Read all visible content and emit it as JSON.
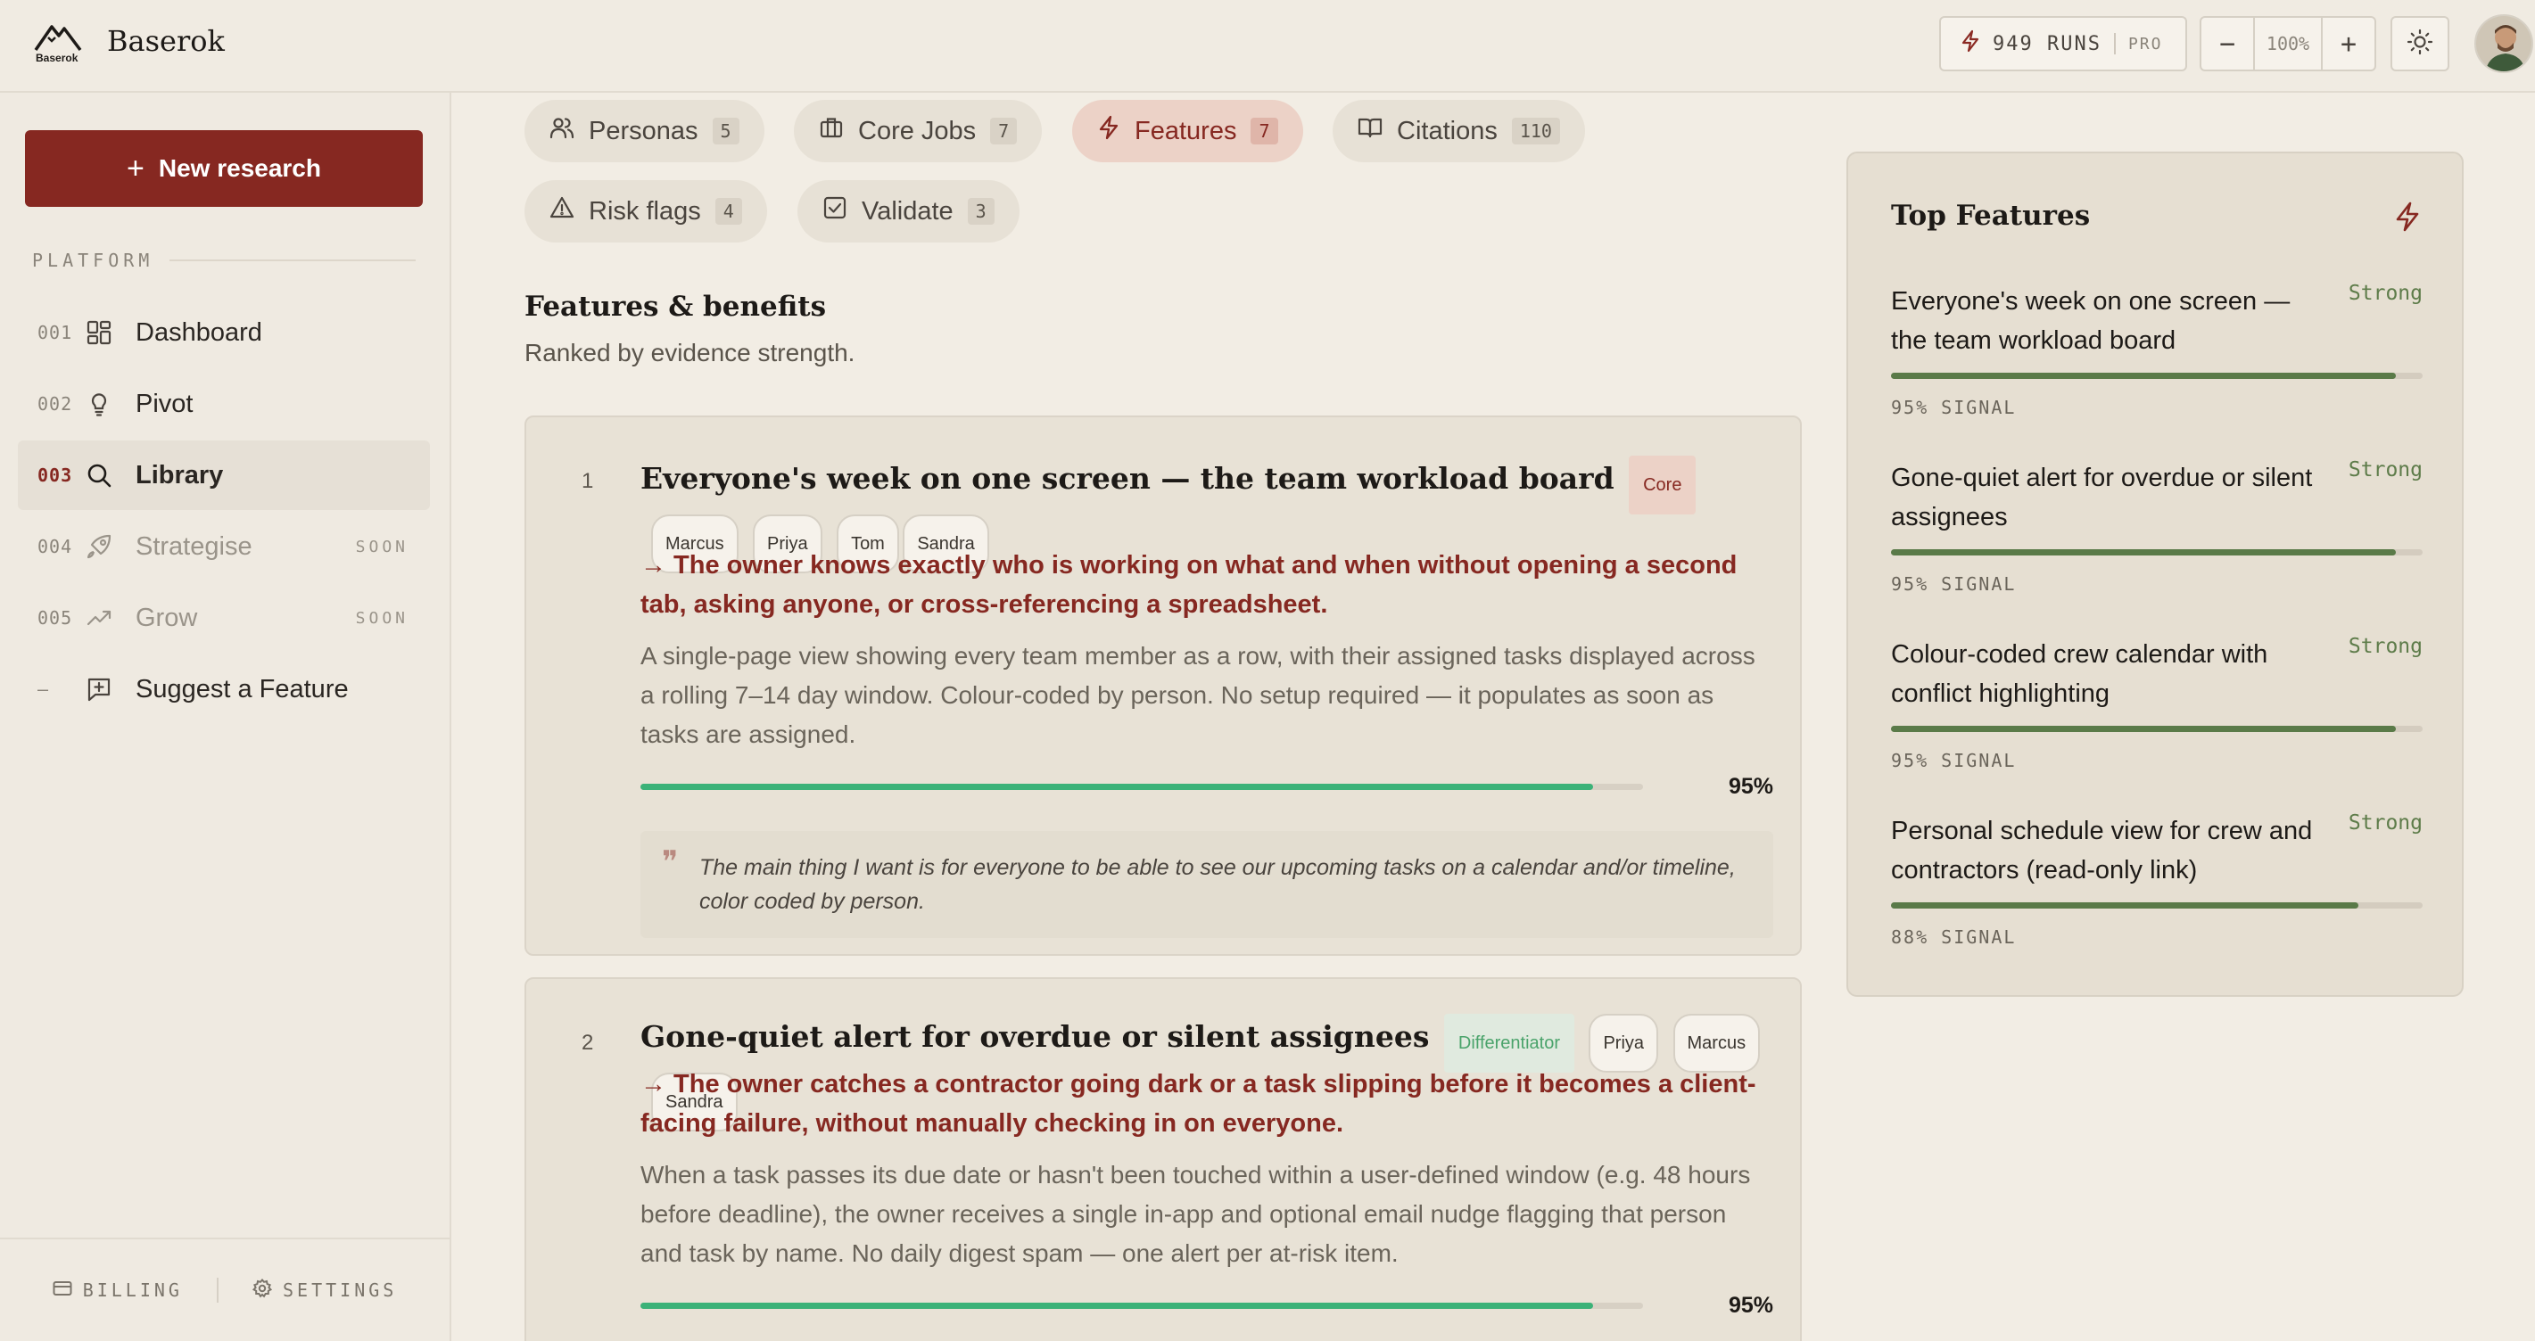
{
  "header": {
    "brand_name": "Baserok",
    "brand_logo_text": "Baserok",
    "runs_label": "949 RUNS",
    "plan_label": "PRO",
    "zoom_value": "100%",
    "zoom_out_label": "−",
    "zoom_in_label": "+"
  },
  "sidebar": {
    "new_research_label": "New research",
    "section_label": "PLATFORM",
    "items": [
      {
        "num": "001",
        "label": "Dashboard",
        "icon": "grid-icon",
        "soon": ""
      },
      {
        "num": "002",
        "label": "Pivot",
        "icon": "lightbulb-icon",
        "soon": ""
      },
      {
        "num": "003",
        "label": "Library",
        "icon": "search-icon",
        "soon": "",
        "active": true
      },
      {
        "num": "004",
        "label": "Strategise",
        "icon": "rocket-icon",
        "soon": "SOON"
      },
      {
        "num": "005",
        "label": "Grow",
        "icon": "trending-up-icon",
        "soon": "SOON"
      },
      {
        "num": "–",
        "label": "Suggest a Feature",
        "icon": "message-plus-icon",
        "soon": ""
      }
    ],
    "footer": {
      "billing_label": "BILLING",
      "settings_label": "SETTINGS"
    }
  },
  "tabs": [
    {
      "label": "Personas",
      "count": "5",
      "icon": "users-icon"
    },
    {
      "label": "Core Jobs",
      "count": "7",
      "icon": "briefcase-icon"
    },
    {
      "label": "Features",
      "count": "7",
      "icon": "bolt-icon",
      "active": true
    },
    {
      "label": "Citations",
      "count": "110",
      "icon": "book-icon"
    },
    {
      "label": "Risk flags",
      "count": "4",
      "icon": "warning-icon"
    },
    {
      "label": "Validate",
      "count": "3",
      "icon": "check-square-icon"
    }
  ],
  "main": {
    "title": "Features & benefits",
    "subtitle": "Ranked by evidence strength."
  },
  "features": [
    {
      "rank": "1",
      "title": "Everyone's week on one screen — the team workload board",
      "category": "Core",
      "personas": [
        "Marcus",
        "Priya",
        "Tom",
        "Sandra"
      ],
      "benefit": "→ The owner knows exactly who is working on what and when without opening a second tab, asking anyone, or cross-referencing a spreadsheet.",
      "description": "A single-page view showing every team member as a row, with their assigned tasks displayed across a rolling 7–14 day window. Colour-coded by person. No setup required — it populates as soon as tasks are assigned.",
      "score": 0.95,
      "score_label": "95%",
      "quote": "The main thing I want is for everyone to be able to see our upcoming tasks on a calendar and/or timeline, color coded by person."
    },
    {
      "rank": "2",
      "title": "Gone-quiet alert for overdue or silent assignees",
      "category": "Differentiator",
      "personas": [
        "Priya",
        "Marcus",
        "Sandra"
      ],
      "benefit": "→ The owner catches a contractor going dark or a task slipping before it becomes a client-facing failure, without manually checking in on everyone.",
      "description": "When a task passes its due date or hasn't been touched within a user-defined window (e.g. 48 hours before deadline), the owner receives a single in-app and optional email nudge flagging that person and task by name. No daily digest spam — one alert per at-risk item.",
      "score": 0.95,
      "score_label": "95%"
    }
  ],
  "top_features": {
    "title": "Top Features",
    "items": [
      {
        "name": "Everyone's week on one screen — the team workload board",
        "strength": "Strong",
        "signal": 0.95,
        "signal_label": "95% SIGNAL"
      },
      {
        "name": "Gone-quiet alert for overdue or silent assignees",
        "strength": "Strong",
        "signal": 0.95,
        "signal_label": "95% SIGNAL"
      },
      {
        "name": "Colour-coded crew calendar with conflict highlighting",
        "strength": "Strong",
        "signal": 0.95,
        "signal_label": "95% SIGNAL"
      },
      {
        "name": "Personal schedule view for crew and contractors (read-only link)",
        "strength": "Strong",
        "signal": 0.88,
        "signal_label": "88% SIGNAL"
      }
    ]
  },
  "colors": {
    "accent": "#862821",
    "progress": "#3bb278",
    "signal": "#5a7a48"
  }
}
